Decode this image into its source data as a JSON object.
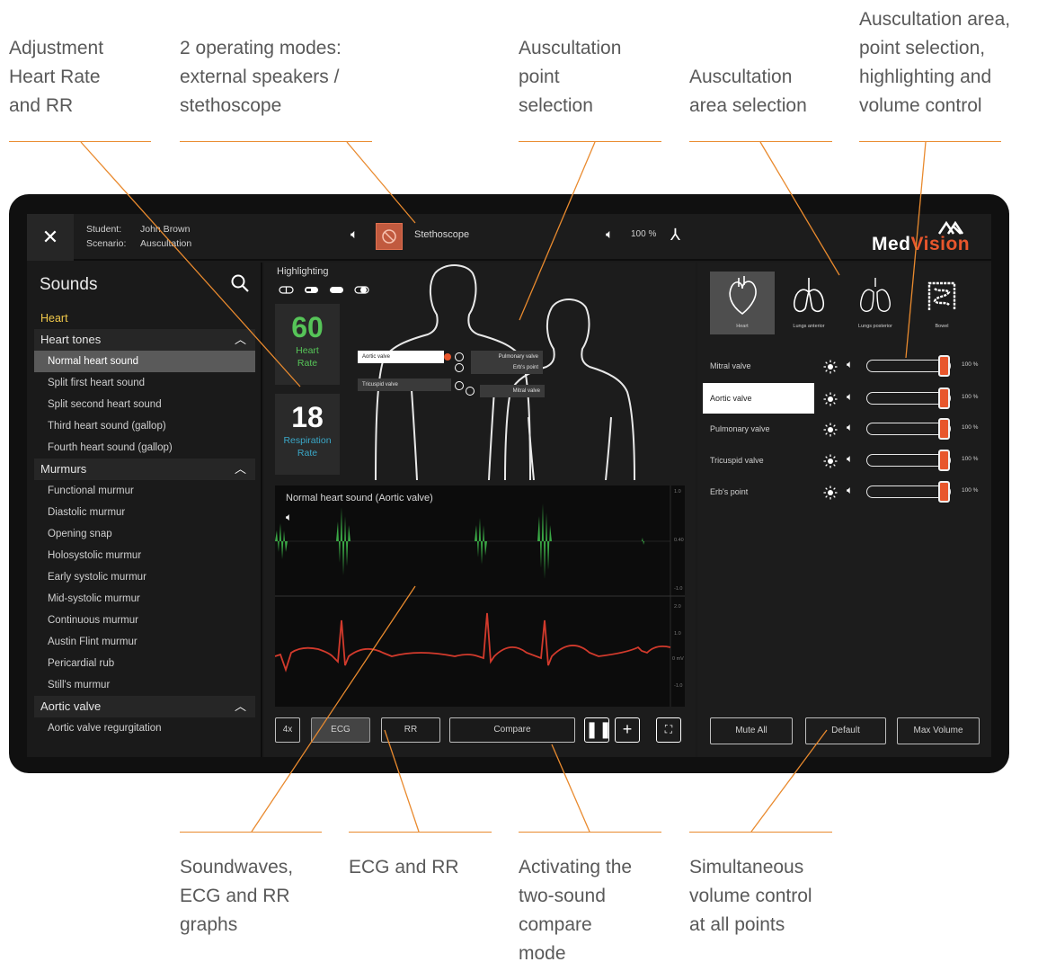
{
  "callouts": {
    "top": [
      [
        "Adjustment",
        "Heart Rate",
        "and RR"
      ],
      [
        "2 operating modes:",
        "external speakers /",
        "stethoscope"
      ],
      [
        "Auscultation",
        "point",
        "selection"
      ],
      [
        "Auscultation",
        "area selection"
      ],
      [
        "Auscultation area,",
        "point selection,",
        "highlighting and",
        "volume control"
      ]
    ],
    "bottom": [
      [
        "Soundwaves,",
        "ECG and RR",
        "graphs"
      ],
      [
        "ECG and RR"
      ],
      [
        "Activating the",
        "two-sound",
        "compare",
        "mode"
      ],
      [
        "Simultaneous",
        "volume control",
        "at all points"
      ]
    ]
  },
  "topbar": {
    "close_icon": "close-icon",
    "student_key": "Student:",
    "student_value": "John Brown",
    "scenario_key": "Scenario:",
    "scenario_value": "Auscultation",
    "mode_label": "Stethoscope",
    "volume": "100 %",
    "logo_text_a": "Med",
    "logo_text_b": "Vision"
  },
  "sidebar": {
    "title": "Sounds",
    "rows": [
      {
        "label": "Heart",
        "type": "cat"
      },
      {
        "label": "Heart tones",
        "type": "group"
      },
      {
        "label": "Normal heart sound",
        "type": "sel"
      },
      {
        "label": "Split first heart sound",
        "type": "item"
      },
      {
        "label": "Split second heart sound",
        "type": "item"
      },
      {
        "label": "Third heart sound (gallop)",
        "type": "item"
      },
      {
        "label": "Fourth heart sound (gallop)",
        "type": "item"
      },
      {
        "label": "Murmurs",
        "type": "group"
      },
      {
        "label": "Functional murmur",
        "type": "item"
      },
      {
        "label": "Diastolic murmur",
        "type": "item"
      },
      {
        "label": "Opening snap",
        "type": "item"
      },
      {
        "label": "Holosystolic murmur",
        "type": "item"
      },
      {
        "label": "Early systolic murmur",
        "type": "item"
      },
      {
        "label": "Mid-systolic murmur",
        "type": "item"
      },
      {
        "label": "Continuous murmur",
        "type": "item"
      },
      {
        "label": "Austin Flint murmur",
        "type": "item"
      },
      {
        "label": "Pericardial rub",
        "type": "item"
      },
      {
        "label": "Still's murmur",
        "type": "item"
      },
      {
        "label": "Aortic valve",
        "type": "group"
      },
      {
        "label": "Aortic valve regurgitation",
        "type": "item"
      }
    ]
  },
  "center": {
    "highlighting_label": "Highlighting",
    "heart_rate": {
      "value": "60",
      "label_1": "Heart",
      "label_2": "Rate"
    },
    "resp_rate": {
      "value": "18",
      "label_1": "Respiration",
      "label_2": "Rate"
    },
    "points": {
      "aortic": "Aortic valve",
      "pulmonary": "Pulmonary valve",
      "erbs": "Erb's point",
      "tricuspid": "Tricuspid valve",
      "mitral": "Mitral valve"
    },
    "graph_title": "Normal heart sound (Aortic valve)",
    "axis": {
      "t1": "1.0",
      "t2": "0.40",
      "t3": "-1.0",
      "t4": "2.0",
      "t5": "1.0",
      "t6": "0 mV",
      "t7": "-1.0"
    },
    "controls": {
      "speed": "4x",
      "ecg": "ECG",
      "rr": "RR",
      "compare": "Compare"
    }
  },
  "right": {
    "areas": [
      "Heart",
      "Lungs anterior",
      "Lungs posterior",
      "Bowel"
    ],
    "volume_rows": [
      {
        "label": "Mitral valve",
        "pct": "100 %",
        "level": 1.0
      },
      {
        "label": "Aortic valve",
        "pct": "100 %",
        "level": 1.0
      },
      {
        "label": "Pulmonary valve",
        "pct": "100 %",
        "level": 1.0
      },
      {
        "label": "Tricuspid valve",
        "pct": "100 %",
        "level": 1.0
      },
      {
        "label": "Erb's point",
        "pct": "100 %",
        "level": 1.0
      }
    ],
    "mute_all": "Mute All",
    "default": "Default",
    "max_volume": "Max Volume"
  },
  "colors": {
    "accent": "#e8562c",
    "callout_line": "#e98a2e",
    "wave_green": "#3aa845",
    "ecg_red": "#d23a2c",
    "hr_green": "#56c458",
    "rr_blue": "#3aa7c7"
  }
}
